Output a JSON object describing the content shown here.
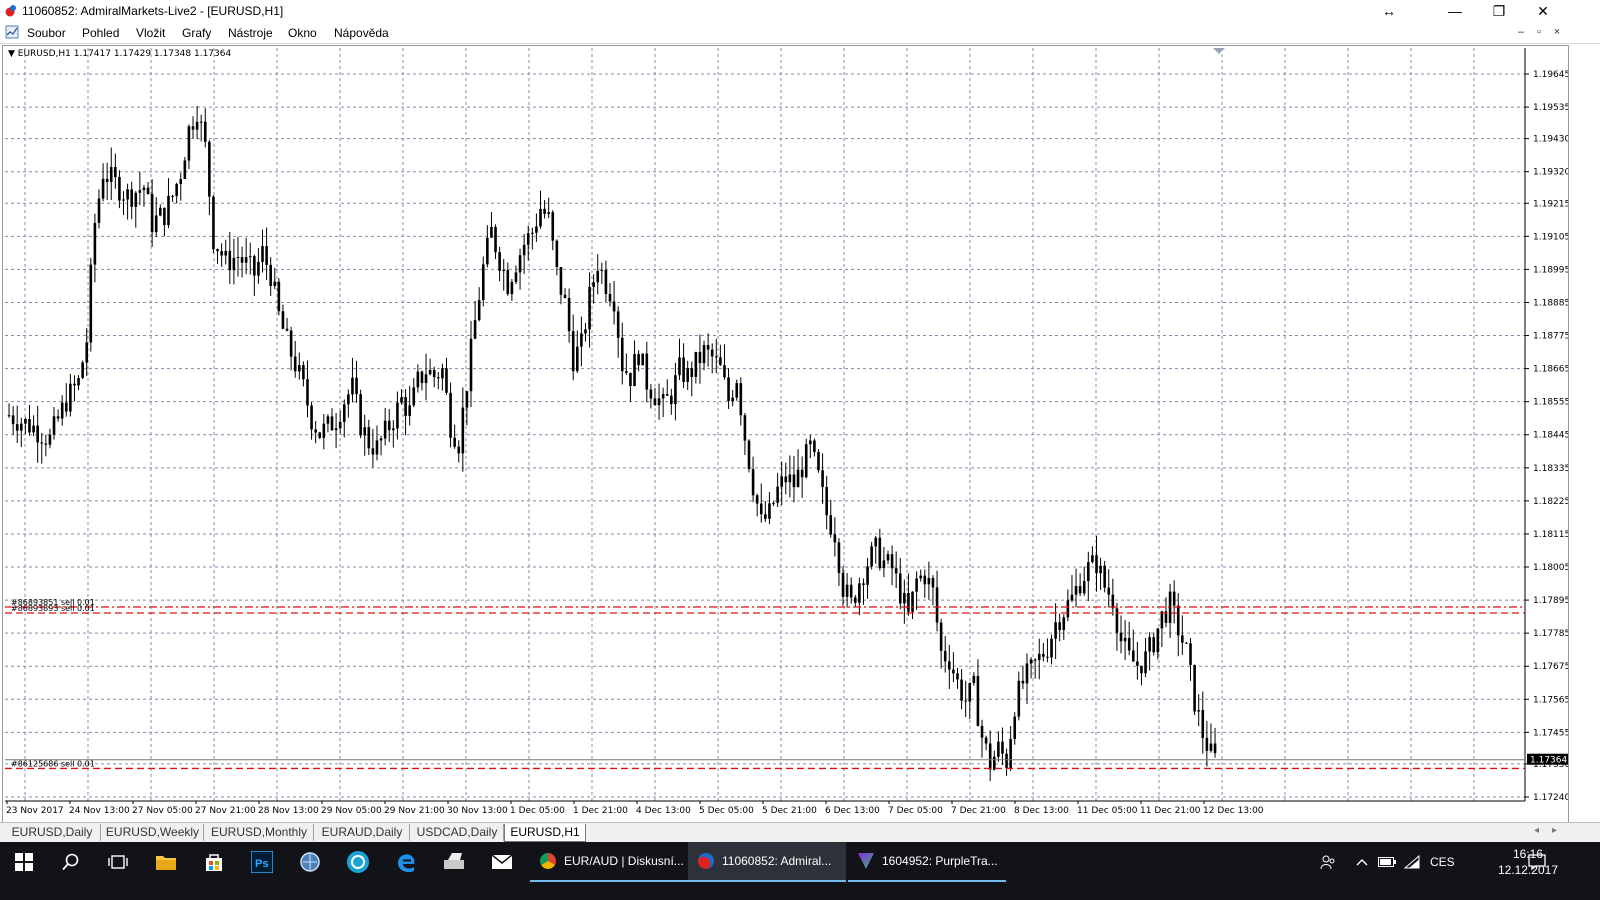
{
  "window": {
    "title": "11060852: AdmiralMarkets-Live2 - [EURUSD,H1]",
    "buttons": {
      "resize": "↔",
      "minimize": "—",
      "restore": "❐",
      "close": "✕"
    }
  },
  "menu": [
    "Soubor",
    "Pohled",
    "Vložit",
    "Grafy",
    "Nástroje",
    "Okno",
    "Nápověda"
  ],
  "mdi_buttons": {
    "minimize": "–",
    "restore": "▫",
    "close": "×"
  },
  "chart_header": "▼ EURUSD,H1  1.17417 1.17429 1.17348 1.17364",
  "order_labels": {
    "sell1": "#86893851 sell 0.01",
    "sell2": "#86893893 sell 0.01",
    "sell3": "#86125686 sell 0.01"
  },
  "chart_data": {
    "type": "candlestick",
    "symbol": "EURUSD",
    "timeframe": "H1",
    "ohlc_last": {
      "open": 1.17417,
      "high": 1.17429,
      "low": 1.17348,
      "close": 1.17364
    },
    "current_price_label": "1.17364",
    "ylim": [
      1.1724,
      1.197
    ],
    "y_ticks": [
      "1.19645",
      "1.19535",
      "1.19430",
      "1.19320",
      "1.19215",
      "1.19105",
      "1.18995",
      "1.18885",
      "1.18775",
      "1.18665",
      "1.18555",
      "1.18445",
      "1.18335",
      "1.18225",
      "1.18115",
      "1.18005",
      "1.17895",
      "1.17785",
      "1.17675",
      "1.17565",
      "1.17455",
      "1.17350",
      "1.17240"
    ],
    "x_ticks": [
      "23 Nov 2017",
      "24 Nov 13:00",
      "27 Nov 05:00",
      "27 Nov 21:00",
      "28 Nov 13:00",
      "29 Nov 05:00",
      "29 Nov 21:00",
      "30 Nov 13:00",
      "1 Dec 05:00",
      "1 Dec 21:00",
      "4 Dec 13:00",
      "5 Dec 05:00",
      "5 Dec 21:00",
      "6 Dec 13:00",
      "7 Dec 05:00",
      "7 Dec 21:00",
      "8 Dec 13:00",
      "11 Dec 05:00",
      "11 Dec 21:00",
      "12 Dec 13:00"
    ],
    "approx_close_path": [
      [
        0,
        1.1851
      ],
      [
        6,
        1.1847
      ],
      [
        10,
        1.1843
      ],
      [
        14,
        1.1856
      ],
      [
        17,
        1.1862
      ],
      [
        19,
        1.1876
      ],
      [
        20,
        1.1897
      ],
      [
        21,
        1.1915
      ],
      [
        23,
        1.1932
      ],
      [
        26,
        1.1928
      ],
      [
        29,
        1.1924
      ],
      [
        33,
        1.1927
      ],
      [
        35,
        1.1915
      ],
      [
        38,
        1.1918
      ],
      [
        40,
        1.1924
      ],
      [
        42,
        1.1932
      ],
      [
        44,
        1.1946
      ],
      [
        46,
        1.1953
      ],
      [
        48,
        1.194
      ],
      [
        50,
        1.191
      ],
      [
        53,
        1.1902
      ],
      [
        56,
        1.1904
      ],
      [
        60,
        1.1898
      ],
      [
        62,
        1.1905
      ],
      [
        64,
        1.1898
      ],
      [
        66,
        1.1884
      ],
      [
        68,
        1.1875
      ],
      [
        70,
        1.1868
      ],
      [
        72,
        1.186
      ],
      [
        74,
        1.185
      ],
      [
        76,
        1.1845
      ],
      [
        78,
        1.1847
      ],
      [
        80,
        1.185
      ],
      [
        82,
        1.1856
      ],
      [
        84,
        1.186
      ],
      [
        86,
        1.1848
      ],
      [
        88,
        1.1842
      ],
      [
        90,
        1.184
      ],
      [
        92,
        1.1845
      ],
      [
        94,
        1.185
      ],
      [
        96,
        1.1856
      ],
      [
        98,
        1.1852
      ],
      [
        100,
        1.1862
      ],
      [
        102,
        1.1866
      ],
      [
        104,
        1.1864
      ],
      [
        106,
        1.1866
      ],
      [
        108,
        1.1848
      ],
      [
        110,
        1.1842
      ],
      [
        112,
        1.1862
      ],
      [
        114,
        1.1882
      ],
      [
        116,
        1.19
      ],
      [
        118,
        1.1912
      ],
      [
        120,
        1.1903
      ],
      [
        122,
        1.1895
      ],
      [
        124,
        1.1902
      ],
      [
        126,
        1.1908
      ],
      [
        128,
        1.1912
      ],
      [
        130,
        1.192
      ],
      [
        132,
        1.1916
      ],
      [
        134,
        1.1898
      ],
      [
        136,
        1.1888
      ],
      [
        138,
        1.187
      ],
      [
        140,
        1.1874
      ],
      [
        142,
        1.189
      ],
      [
        144,
        1.1902
      ],
      [
        146,
        1.1895
      ],
      [
        148,
        1.189
      ],
      [
        150,
        1.1868
      ],
      [
        152,
        1.1864
      ],
      [
        154,
        1.1872
      ],
      [
        156,
        1.1862
      ],
      [
        158,
        1.1858
      ],
      [
        160,
        1.1854
      ],
      [
        162,
        1.1858
      ],
      [
        164,
        1.1866
      ],
      [
        166,
        1.1864
      ],
      [
        168,
        1.1868
      ],
      [
        170,
        1.1872
      ],
      [
        172,
        1.187
      ],
      [
        174,
        1.1866
      ],
      [
        176,
        1.1856
      ],
      [
        178,
        1.1864
      ],
      [
        180,
        1.1844
      ],
      [
        182,
        1.1828
      ],
      [
        184,
        1.1815
      ],
      [
        186,
        1.1818
      ],
      [
        188,
        1.1826
      ],
      [
        190,
        1.183
      ],
      [
        192,
        1.1828
      ],
      [
        194,
        1.1834
      ],
      [
        196,
        1.184
      ],
      [
        198,
        1.183
      ],
      [
        200,
        1.1818
      ],
      [
        202,
        1.1812
      ],
      [
        204,
        1.1794
      ],
      [
        206,
        1.1788
      ],
      [
        208,
        1.1796
      ],
      [
        210,
        1.1802
      ],
      [
        212,
        1.1806
      ],
      [
        214,
        1.1802
      ],
      [
        216,
        1.18
      ],
      [
        218,
        1.1792
      ],
      [
        220,
        1.1784
      ],
      [
        222,
        1.1796
      ],
      [
        224,
        1.1798
      ],
      [
        226,
        1.1792
      ],
      [
        228,
        1.1772
      ],
      [
        230,
        1.177
      ],
      [
        232,
        1.1762
      ],
      [
        234,
        1.1756
      ],
      [
        236,
        1.176
      ],
      [
        238,
        1.1744
      ],
      [
        240,
        1.1735
      ],
      [
        242,
        1.174
      ],
      [
        244,
        1.1736
      ],
      [
        246,
        1.1755
      ],
      [
        248,
        1.1762
      ],
      [
        250,
        1.1766
      ],
      [
        252,
        1.177
      ],
      [
        254,
        1.1774
      ],
      [
        256,
        1.1782
      ],
      [
        258,
        1.1786
      ],
      [
        260,
        1.179
      ],
      [
        262,
        1.1796
      ],
      [
        264,
        1.18
      ],
      [
        266,
        1.1802
      ],
      [
        268,
        1.1794
      ],
      [
        270,
        1.179
      ],
      [
        272,
        1.1776
      ],
      [
        274,
        1.177
      ],
      [
        276,
        1.1768
      ],
      [
        278,
        1.177
      ],
      [
        280,
        1.1776
      ],
      [
        282,
        1.1784
      ],
      [
        284,
        1.1788
      ],
      [
        286,
        1.178
      ],
      [
        288,
        1.1772
      ],
      [
        290,
        1.1756
      ],
      [
        292,
        1.1745
      ],
      [
        294,
        1.1738
      ],
      [
        295,
        1.17364
      ]
    ],
    "grid": true,
    "background": "#ffffff",
    "candle_color": "#000000",
    "grid_color": "#7f8fa6",
    "level_lines": [
      {
        "label": "#86893851 sell 0.01",
        "price": 1.17872,
        "style": "dash-dot",
        "color": "#e01010"
      },
      {
        "label": "#86893893 sell 0.01",
        "price": 1.17852,
        "style": "dash",
        "color": "#e01010"
      },
      {
        "label": "#86125686 sell 0.01",
        "price": 1.17335,
        "style": "dash",
        "color": "#e01010"
      }
    ],
    "bid_line": {
      "price": 1.17364,
      "color": "#777777"
    }
  },
  "tabs": [
    {
      "label": "EURUSD,Daily",
      "active": false
    },
    {
      "label": "EURUSD,Weekly",
      "active": false
    },
    {
      "label": "EURUSD,Monthly",
      "active": false
    },
    {
      "label": "EURAUD,Daily",
      "active": false
    },
    {
      "label": "USDCAD,Daily",
      "active": false
    },
    {
      "label": "EURUSD,H1",
      "active": true
    }
  ],
  "tab_scroll": {
    "left": "◂",
    "right": "▸"
  },
  "taskbar": {
    "tasks": [
      {
        "label": "EUR/AUD | Diskusní...",
        "state": "open"
      },
      {
        "label": "11060852: Admiral...",
        "state": "active"
      },
      {
        "label": "1604952: PurpleTra...",
        "state": "open"
      }
    ],
    "language": "CES",
    "time": "16:16",
    "date": "12.12.2017"
  }
}
